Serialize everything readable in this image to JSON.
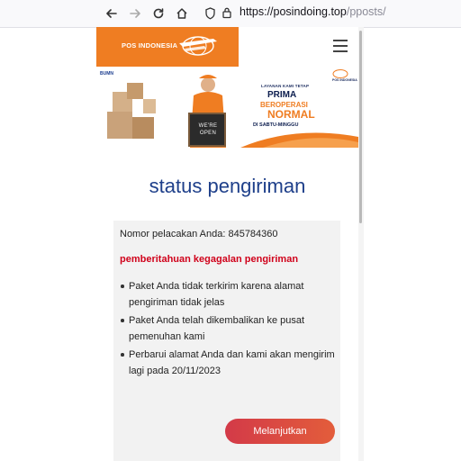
{
  "browser": {
    "url_host": "https://posindoing.top",
    "url_path": "/pposts/"
  },
  "site": {
    "logo_text": "POS INDONESIA",
    "brand_color": "#ef7d22"
  },
  "banner": {
    "bumn": "BUMN",
    "line1": "LAYANAN KAMI TETAP",
    "line2": "PRIMA",
    "line3": "BEROPERASI",
    "line4": "NORMAL",
    "line5": "DI SABTU-MINGGU",
    "corner_logo": "POS INDONESIA",
    "board": "WE'RE OPEN"
  },
  "page": {
    "title": "status pengiriman",
    "title_color": "#1e3f8a"
  },
  "notice": {
    "tracking_text": "Nomor pelacakan Anda: 845784360",
    "warning": "pemberitahuan kegagalan pengiriman",
    "warning_color": "#d0021b",
    "items": [
      "Paket Anda tidak terkirim karena alamat pengiriman tidak jelas",
      "Paket Anda telah dikembalikan ke pusat pemenuhan kami",
      "Perbarui alamat Anda dan kami akan mengirim lagi pada 20/11/2023"
    ],
    "continue_label": "Melanjutkan"
  }
}
